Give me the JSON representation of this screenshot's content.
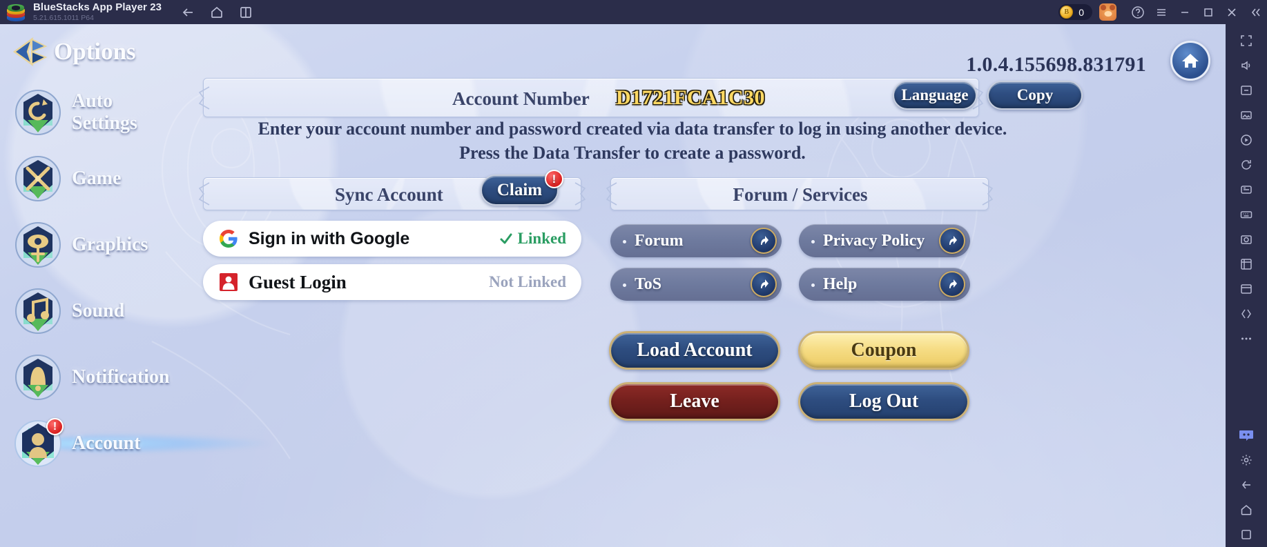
{
  "window": {
    "app_title": "BlueStacks App Player 23",
    "app_version": "5.21.615.1011  P64",
    "nav": [
      {
        "name": "back-icon",
        "label": "Back"
      },
      {
        "name": "home-icon",
        "label": "Home"
      },
      {
        "name": "multi-instance-icon",
        "label": "Instances"
      }
    ],
    "coin_count": "0",
    "controls": [
      {
        "name": "account-avatar-icon",
        "label": "Account"
      },
      {
        "name": "help-icon",
        "label": "Help"
      },
      {
        "name": "menu-icon",
        "label": "Menu"
      },
      {
        "name": "minimize-icon",
        "label": "Minimize"
      },
      {
        "name": "maximize-icon",
        "label": "Maximize"
      },
      {
        "name": "close-icon",
        "label": "Close"
      },
      {
        "name": "collapse-icon",
        "label": "Collapse"
      }
    ]
  },
  "rail": {
    "icons": [
      "fullscreen-icon",
      "volume-icon",
      "screenshot-icon",
      "gallery-icon",
      "video-record-icon",
      "rotate-icon",
      "macro-icon",
      "keymap-icon",
      "camera-icon",
      "trim-icon",
      "media-manager-icon",
      "script-icon",
      "more-icon",
      "discord-icon",
      "settings-icon",
      "back-icon",
      "home-icon",
      "recents-icon"
    ]
  },
  "game": {
    "page_title": "Options",
    "version": "1.0.4.155698.831791",
    "sidebar": [
      {
        "label": "Auto Settings",
        "icon": "auto-settings-crest-icon",
        "selected": false,
        "alert": false
      },
      {
        "label": "Game",
        "icon": "game-crest-icon",
        "selected": false,
        "alert": false
      },
      {
        "label": "Graphics",
        "icon": "graphics-crest-icon",
        "selected": false,
        "alert": false
      },
      {
        "label": "Sound",
        "icon": "sound-crest-icon",
        "selected": false,
        "alert": false
      },
      {
        "label": "Notification",
        "icon": "notification-crest-icon",
        "selected": false,
        "alert": false
      },
      {
        "label": "Account",
        "icon": "account-crest-icon",
        "selected": true,
        "alert": true
      }
    ],
    "account": {
      "label": "Account Number",
      "code": "D1721FCA1C30",
      "language_button": "Language",
      "copy_button": "Copy",
      "notice_line1": "Enter your account number and password created via data transfer to log in using another device.",
      "notice_line2": "Press the Data Transfer to create a password."
    },
    "sync": {
      "title": "Sync Account",
      "claim_button": "Claim",
      "claim_alert": "!",
      "logins": [
        {
          "name": "Sign in with Google",
          "icon": "google-logo-icon",
          "status": "Linked",
          "linked": true
        },
        {
          "name": "Guest Login",
          "icon": "guest-person-icon",
          "status": "Not Linked",
          "linked": false
        }
      ]
    },
    "forum": {
      "title": "Forum / Services",
      "links": [
        {
          "label": "Forum",
          "icon": "external-link-icon"
        },
        {
          "label": "Privacy Policy",
          "icon": "external-link-icon"
        },
        {
          "label": "ToS",
          "icon": "external-link-icon"
        },
        {
          "label": "Help",
          "icon": "external-link-icon"
        }
      ]
    },
    "actions": [
      {
        "label": "Load Account",
        "style": "navy"
      },
      {
        "label": "Coupon",
        "style": "gold"
      },
      {
        "label": "Leave",
        "style": "red"
      },
      {
        "label": "Log Out",
        "style": "navy"
      }
    ],
    "colors": {
      "accent_navy": "#2e4d80",
      "accent_gold": "#f6dd86",
      "accent_red": "#74201d",
      "link_grey": "#6e7a9e",
      "code_gold": "#ffd963",
      "linked_green": "#2a9d62",
      "alert_red": "#d81f1f"
    }
  }
}
